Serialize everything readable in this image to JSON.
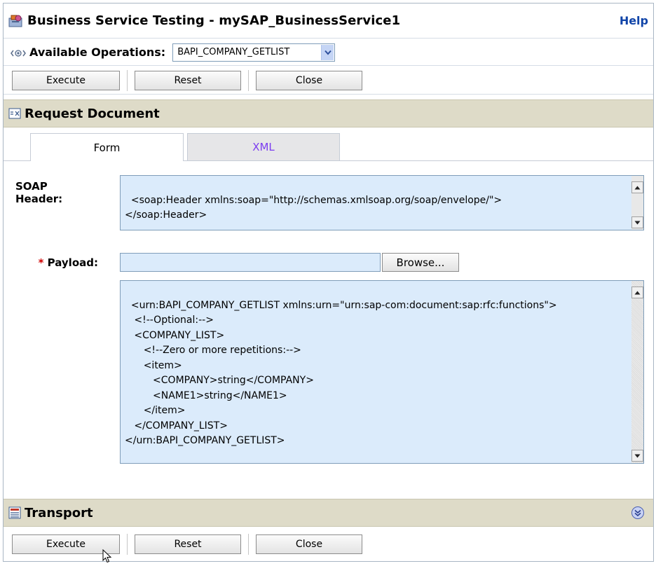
{
  "header": {
    "title": "Business Service Testing - mySAP_BusinessService1",
    "help_label": "Help",
    "icon": "business-service-icon"
  },
  "operations": {
    "label": "Available Operations:",
    "selected": "BAPI_COMPANY_GETLIST",
    "icon": "operations-icon"
  },
  "toolbar": {
    "execute_label": "Execute",
    "reset_label": "Reset",
    "close_label": "Close"
  },
  "request": {
    "title": "Request Document",
    "icon": "request-document-icon",
    "tabs": [
      {
        "label": "Form",
        "active": true
      },
      {
        "label": "XML",
        "active": false
      }
    ],
    "soap_header_label": "SOAP Header:",
    "soap_header_value": "<soap:Header xmlns:soap=\"http://schemas.xmlsoap.org/soap/envelope/\">\n</soap:Header>",
    "payload_label": "Payload:",
    "payload_required": "*",
    "browse_label": "Browse...",
    "payload_value": "<urn:BAPI_COMPANY_GETLIST xmlns:urn=\"urn:sap-com:document:sap:rfc:functions\">\n   <!--Optional:-->\n   <COMPANY_LIST>\n      <!--Zero or more repetitions:-->\n      <item>\n         <COMPANY>string</COMPANY>\n         <NAME1>string</NAME1>\n      </item>\n   </COMPANY_LIST>\n</urn:BAPI_COMPANY_GETLIST>"
  },
  "transport": {
    "title": "Transport",
    "icon": "transport-icon",
    "expand_icon": "expand-icon"
  },
  "colors": {
    "section_bar": "#dedbc8",
    "field_bg": "#dbebfb",
    "help_link": "#1044a8",
    "xml_tab_text": "#7c3df0",
    "required_star": "#d00000"
  }
}
